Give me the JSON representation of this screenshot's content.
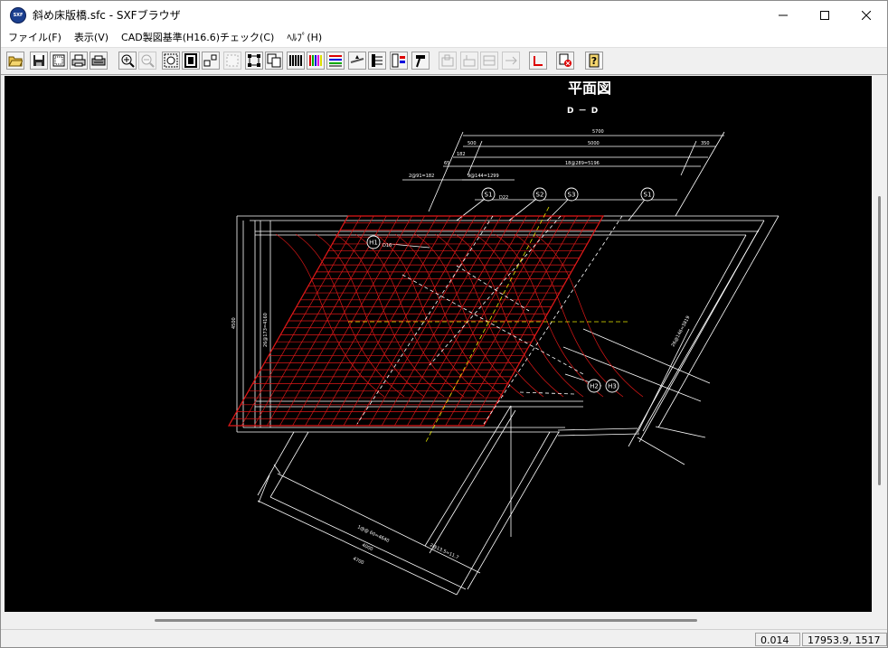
{
  "window": {
    "title": "斜め床版橋.sfc - SXFブラウザ",
    "app_icon_text": "SXF",
    "controls": [
      "minimize-icon",
      "maximize-icon",
      "close-icon"
    ]
  },
  "menu": [
    {
      "label": "ファイル(F)"
    },
    {
      "label": "表示(V)"
    },
    {
      "label": "CAD製図基準(H16.6)チェック(C)"
    },
    {
      "label": "ﾍﾙﾌﾟ(H)"
    }
  ],
  "toolbar": {
    "buttons": [
      {
        "name": "open-file-icon",
        "enabled": true
      },
      {
        "name": "save-icon",
        "enabled": true
      },
      {
        "name": "print-preview-icon",
        "enabled": true
      },
      {
        "name": "print-icon",
        "enabled": true
      },
      {
        "name": "print-setup-icon",
        "enabled": true
      },
      {
        "name": "zoom-in-icon",
        "enabled": true
      },
      {
        "name": "zoom-out-icon",
        "enabled": false
      },
      {
        "name": "zoom-fit-icon",
        "enabled": true
      },
      {
        "name": "zoom-paper-icon",
        "enabled": true
      },
      {
        "name": "zoom-window-icon",
        "enabled": true
      },
      {
        "name": "pan-icon",
        "enabled": false
      },
      {
        "name": "redraw-icon",
        "enabled": true
      },
      {
        "name": "sheet-list-icon",
        "enabled": true
      },
      {
        "name": "layer-icon",
        "enabled": true
      },
      {
        "name": "color-icon",
        "enabled": true
      },
      {
        "name": "line-type-icon",
        "enabled": true
      },
      {
        "name": "measure-icon",
        "enabled": true
      },
      {
        "name": "attribute-icon",
        "enabled": true
      },
      {
        "name": "element-info-icon",
        "enabled": true
      },
      {
        "name": "tool-hammer-icon",
        "enabled": true
      },
      {
        "name": "check-a-icon",
        "enabled": false
      },
      {
        "name": "check-b-icon",
        "enabled": false
      },
      {
        "name": "check-c-icon",
        "enabled": false
      },
      {
        "name": "check-d-icon",
        "enabled": false
      },
      {
        "name": "check-mark-icon",
        "enabled": true
      },
      {
        "name": "clear-check-icon",
        "enabled": true
      },
      {
        "name": "help-icon",
        "enabled": true
      }
    ]
  },
  "drawing": {
    "title": "平面図",
    "subtitle": "D － D",
    "colors": {
      "background": "#000000",
      "linework": "#ffffff",
      "rebar": "#e01818",
      "centerline": "#e8e800"
    },
    "labels": {
      "total_length": "5700",
      "inner_length": "5000",
      "left_offset": "500",
      "right_offset": "350",
      "spacing_top": "18@289=5196",
      "side_a": "65",
      "side_b": "182",
      "left_dim": "2@91=182",
      "mid_dim": "9@144=1299",
      "height_total": "4500",
      "height_mid": "26@173=4160",
      "bottom_dim_1": "1@@ 60=4640",
      "bottom_dim_2": "4000",
      "bottom_dim_3": "4700",
      "lower_spacing": "2@13.5=11.7",
      "bar_tags": [
        "S1",
        "S2",
        "S3",
        "S1",
        "H1",
        "H2",
        "H3"
      ],
      "bar_size_a": "D22",
      "bar_size_b": "D16",
      "right_dim": "26@146=3819"
    }
  },
  "status": {
    "scale": "0.014",
    "coordinates": "17953.9, 1517"
  }
}
